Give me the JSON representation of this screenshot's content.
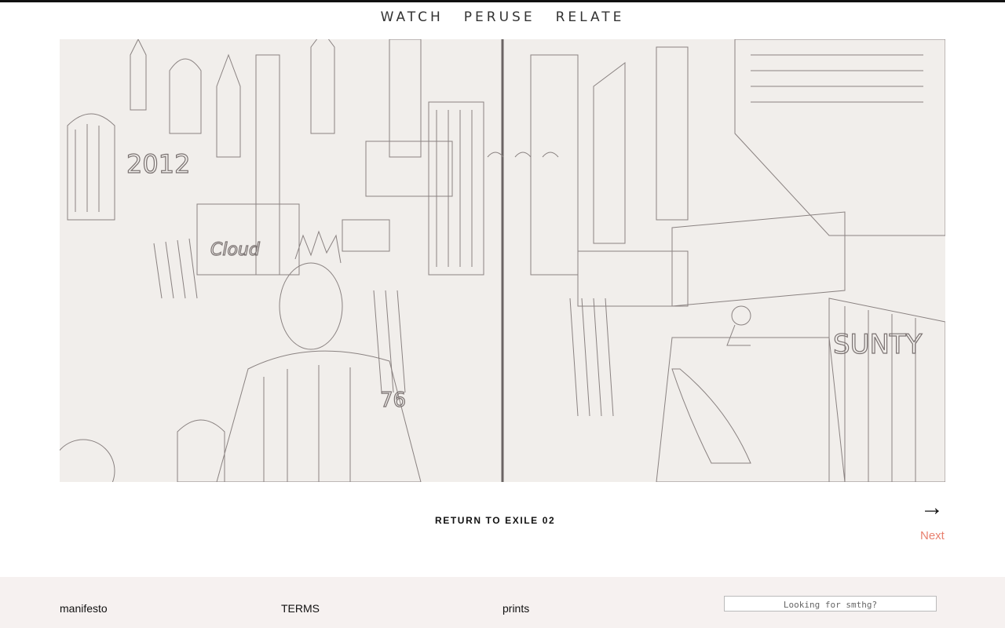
{
  "nav": {
    "items": [
      {
        "label": "WATCH"
      },
      {
        "label": "PERUSE"
      },
      {
        "label": "RELATE"
      }
    ]
  },
  "artwork": {
    "name": "pencil sketch illustration",
    "texts": [
      "2012",
      "Cloud",
      "76",
      "SUNTY"
    ]
  },
  "pager": {
    "return_label": "RETURN TO EXILE 02",
    "next_arrow": "→",
    "next_label": "Next"
  },
  "footer": {
    "links": [
      {
        "label": "manifesto"
      },
      {
        "label": "TERMS"
      },
      {
        "label": "prints"
      }
    ],
    "search_placeholder": "Looking for smthg?"
  },
  "colors": {
    "accent": "#e8806f",
    "footer_bg": "#f6f1f0",
    "paper": "#f1eeeb"
  }
}
